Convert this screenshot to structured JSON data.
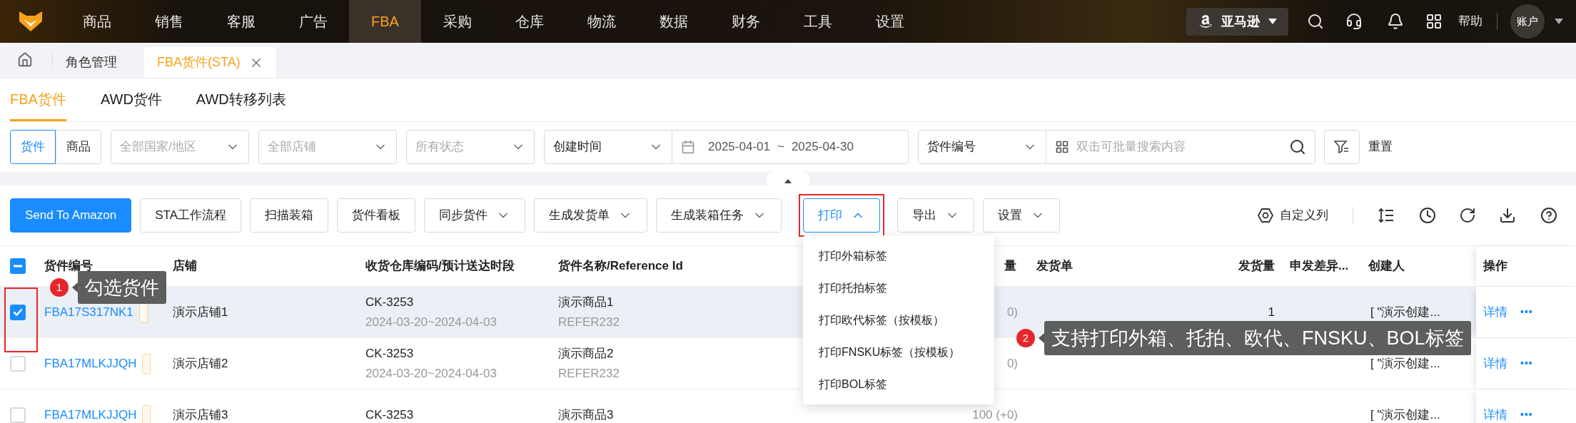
{
  "nav": {
    "items": [
      {
        "label": "商品",
        "selected": false
      },
      {
        "label": "销售",
        "selected": false
      },
      {
        "label": "客服",
        "selected": false
      },
      {
        "label": "广告",
        "selected": false
      },
      {
        "label": "FBA",
        "selected": true
      },
      {
        "label": "采购",
        "selected": false
      },
      {
        "label": "仓库",
        "selected": false
      },
      {
        "label": "物流",
        "selected": false
      },
      {
        "label": "数据",
        "selected": false
      },
      {
        "label": "财务",
        "selected": false
      },
      {
        "label": "工具",
        "selected": false
      },
      {
        "label": "设置",
        "selected": false
      }
    ],
    "platform": "亚马逊",
    "help": "帮助",
    "account": "账户"
  },
  "page_tabs": [
    {
      "label": "角色管理",
      "selected": false,
      "closable": false
    },
    {
      "label": "FBA货件(STA)",
      "selected": true,
      "closable": true
    }
  ],
  "sub_tabs": [
    {
      "label": "FBA货件",
      "selected": true
    },
    {
      "label": "AWD货件",
      "selected": false
    },
    {
      "label": "AWD转移列表",
      "selected": false
    }
  ],
  "filters": {
    "mode_toggle": [
      {
        "label": "货件",
        "selected": true
      },
      {
        "label": "商品",
        "selected": false
      }
    ],
    "selects": [
      {
        "placeholder": "全部国家/地区"
      },
      {
        "placeholder": "全部店铺"
      },
      {
        "placeholder": "所有状态"
      }
    ],
    "date_field": "创建时间",
    "date_start": "2025-04-01",
    "date_sep": "~",
    "date_end": "2025-04-30",
    "search_field": "货件编号",
    "search": {
      "placeholder": "双击可批量搜索内容"
    },
    "reset": "重置"
  },
  "toolbar": {
    "buttons": [
      {
        "label": "Send To Amazon",
        "kind": "primary",
        "expanded": false,
        "highlighted": false
      },
      {
        "label": "STA工作流程",
        "kind": "plain",
        "expanded": false,
        "highlighted": false
      },
      {
        "label": "扫描装箱",
        "kind": "plain",
        "expanded": false,
        "highlighted": false
      },
      {
        "label": "货件看板",
        "kind": "plain",
        "expanded": false,
        "highlighted": false
      },
      {
        "label": "同步货件",
        "kind": "dropdown",
        "expanded": false,
        "highlighted": false
      },
      {
        "label": "生成发货单",
        "kind": "dropdown",
        "expanded": false,
        "highlighted": false
      },
      {
        "label": "生成装箱任务",
        "kind": "dropdown",
        "expanded": false,
        "highlighted": false
      },
      {
        "label": "打印",
        "kind": "dropdown",
        "expanded": true,
        "highlighted": true
      },
      {
        "label": "导出",
        "kind": "dropdown",
        "expanded": false,
        "highlighted": false
      },
      {
        "label": "设置",
        "kind": "dropdown",
        "expanded": false,
        "highlighted": false
      }
    ],
    "custom_columns": "自定义列"
  },
  "print_menu": [
    "打印外箱标签",
    "打印托拍标签",
    "打印欧代标签（按模板）",
    "打印FNSKU标签（按模板）",
    "打印BOL标签"
  ],
  "table": {
    "header_checkbox": {
      "indeterminate": true
    },
    "columns": [
      "货件编号",
      "店铺",
      "收货仓库编码/预计送达时段",
      "货件名称/Reference Id",
      "量",
      "发货单",
      "发货量",
      "申发差异...",
      "创建人",
      "操作"
    ],
    "rows": [
      {
        "checked": true,
        "selected": true,
        "shipment_id": "FBA17S317NK1",
        "store": "演示店铺1",
        "warehouse": "CK-3253",
        "window": "2024-03-20~2024-04-03",
        "product": "演示商品1",
        "reference": "REFER232",
        "qty": "0)",
        "shipped": "1",
        "creator": "[ \"演示创建...",
        "detail": "详情",
        "more": "•••"
      },
      {
        "checked": false,
        "selected": false,
        "shipment_id": "FBA17MLKJJQH",
        "store": "演示店铺2",
        "warehouse": "CK-3253",
        "window": "2024-03-20~2024-04-03",
        "product": "演示商品2",
        "reference": "REFER232",
        "qty": "0)",
        "shipped": "",
        "creator": "[ \"演示创建...",
        "detail": "详情",
        "more": "•••"
      },
      {
        "checked": false,
        "selected": false,
        "shipment_id": "FBA17MLKJJQH",
        "store": "演示店铺3",
        "warehouse": "CK-3253",
        "window": "",
        "product": "演示商品3",
        "reference": "",
        "qty": "100 (+0)",
        "shipped": "",
        "creator": "[ \"演示创建...",
        "detail": "详情",
        "more": "•••"
      }
    ]
  },
  "annotations": [
    {
      "number": "1",
      "text": "勾选货件"
    },
    {
      "number": "2",
      "text": "支持打印外箱、托拍、欧代、FNSKU、BOL标签"
    }
  ]
}
